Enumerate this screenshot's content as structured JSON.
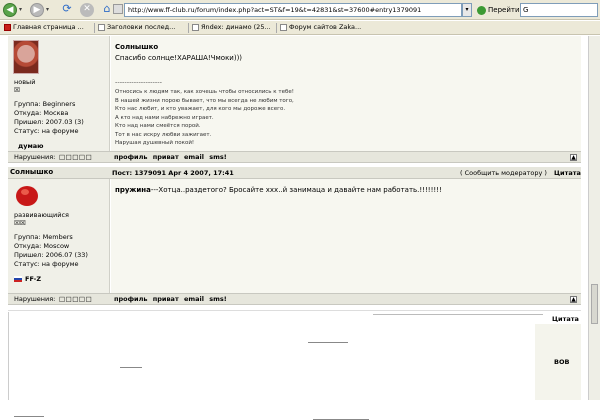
{
  "browser": {
    "address": "http://www.ff-club.ru/forum/index.php?act=ST&f=19&t=42831&st=37600#entry1379091",
    "go_label": "Перейти",
    "search_text": "G"
  },
  "bookmarks": [
    {
      "label": "Главная страница ..."
    },
    {
      "label": "Заголовки послед..."
    },
    {
      "label": "Яndex: динамо (25..."
    },
    {
      "label": "Форум сайтов Zaka..."
    }
  ],
  "post1": {
    "user_title": "новый",
    "user_pips": "☒",
    "group": "Группа: Beginners",
    "from": "Откуда: Москва",
    "joined": "Пришел: 2007.03 (3)",
    "status": "Статус: на форуме",
    "mood": "думаю",
    "author": "Солнышко",
    "text": "Спасибо солнце!ХАРАША!Чмоки)))",
    "dashes": "--------------------",
    "sig": [
      "Относись к людям так, как хочешь чтобы относились к тебе!",
      "В нашей жизни порою бывает, что мы всегда не любим того,",
      "Кто нас любит, и кто уважает, для кого мы дороже всего.",
      "А кто над нами набрежно играет.",
      "Кто над нами смеётся порой.",
      "Тот в нас искру любви зажигает.",
      "Нарушая душевный покой!"
    ],
    "violations": "Нарушения:",
    "boxes": "□□□□□",
    "links": "профиль  приват  email  sms!",
    "collapse": "▲"
  },
  "post2": {
    "author": "Солнышко",
    "meta": "Пост: 1379091 Apr 4 2007, 17:41",
    "report": "( Сообщить модератору )",
    "quote": "Цитата",
    "lead": "пружина",
    "text": "---Хотца..раздетого? Бросайте ххх..й занимаца и давайте нам работать.!!!!!!!!",
    "user_title": "развивающийся",
    "user_pips": "☒☒",
    "group": "Группа: Members",
    "from": "Откуда: Moscow",
    "joined": "Пришел: 2006.07 (33)",
    "status": "Статус: на форуме",
    "mood": "FF-Z",
    "violations": "Нарушения:",
    "boxes": "□□□□□",
    "links": "профиль  приват  email  sms!",
    "collapse": "▲"
  },
  "post3": {
    "quote": "Цитата",
    "right_val": "ВОВ"
  }
}
